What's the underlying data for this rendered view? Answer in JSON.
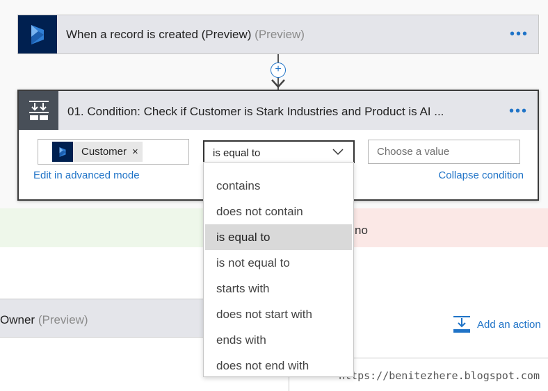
{
  "trigger": {
    "title": "When a record is created (Preview)",
    "suffix": "(Preview)",
    "menu": "•••"
  },
  "connector": {
    "add_symbol": "+"
  },
  "condition": {
    "title": "01. Condition: Check if Customer is Stark Industries and Product is AI ...",
    "menu": "•••",
    "token_label": "Customer",
    "token_remove": "×",
    "operator_value": "is equal to",
    "value_placeholder": "Choose a value",
    "edit_advanced_label": "Edit in advanced mode",
    "collapse_label": "Collapse condition"
  },
  "dropdown": {
    "options": [
      "contains",
      "does not contain",
      "is equal to",
      "is not equal to",
      "starts with",
      "does not start with",
      "ends with",
      "does not end with"
    ],
    "selected": "is equal to"
  },
  "branches": {
    "no_label": "no",
    "owner_title": "Owner",
    "owner_suffix": "(Preview)",
    "add_action_label": "Add an action"
  },
  "watermark": "https://benitezhere.blogspot.com",
  "colors": {
    "accent": "#1f73c7",
    "dynamics_badge": "#002050",
    "condition_badge": "#484f58",
    "yes_branch": "#eef7ea",
    "no_branch": "#fbe8e6"
  }
}
